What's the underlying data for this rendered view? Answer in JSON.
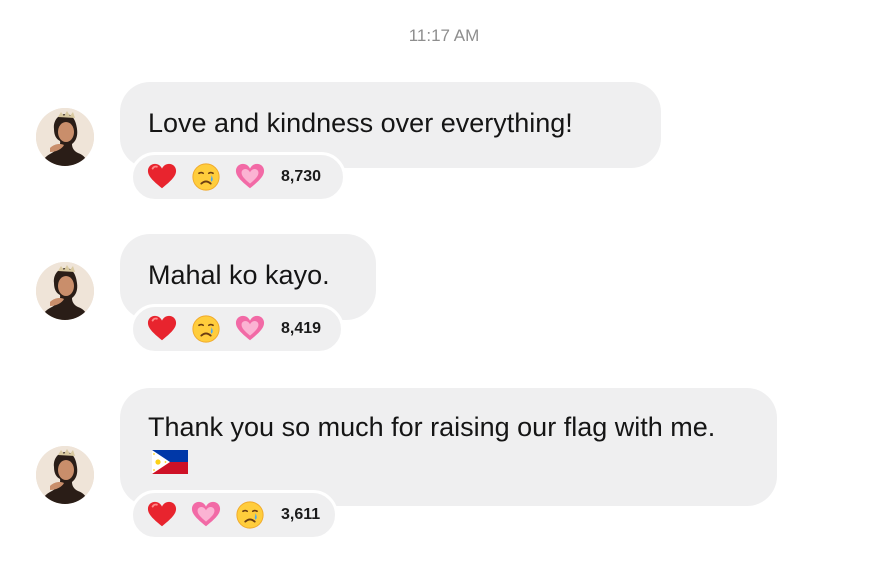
{
  "timestamp": "11:17 AM",
  "messages": [
    {
      "text": "Love and kindness over everything!",
      "reactions": [
        "red-heart",
        "crying-face",
        "pink-heart"
      ],
      "count": "8,730"
    },
    {
      "text": "Mahal ko kayo.",
      "reactions": [
        "red-heart",
        "crying-face",
        "pink-heart"
      ],
      "count": "8,419"
    },
    {
      "text": "Thank you so much for raising our flag with me.",
      "flag": "philippines-flag-emoji",
      "reactions": [
        "red-heart",
        "pink-heart",
        "crying-face"
      ],
      "count": "3,611"
    }
  ],
  "colors": {
    "bubble": "#efeff0",
    "timestamp": "#8e8e8e",
    "heart_red": "#e8242e",
    "heart_pink": "#f06aa8"
  }
}
